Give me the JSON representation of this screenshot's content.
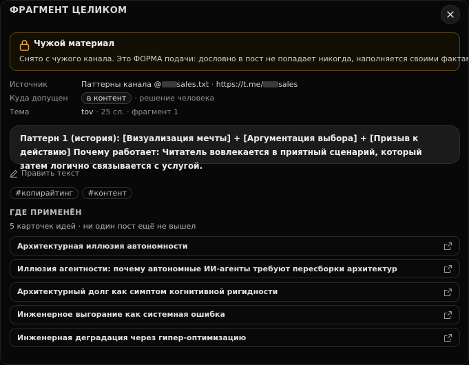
{
  "modal": {
    "title": "ФРАГМЕНТ ЦЕЛИКОМ",
    "close_icon": "close-icon"
  },
  "warning": {
    "icon": "lock-icon",
    "title": "Чужой материал",
    "text": "Снято с чужого канала. Это ФОРМА подачи: дословно в пост не попадает никогда, наполняется своими фактами.",
    "border_color": "#5e4617"
  },
  "meta": {
    "source": {
      "label": "Источник",
      "file_prefix": "Паттерны канала @",
      "file_suffix": "sales.txt",
      "url_sep": " · ",
      "url_prefix": "https://t.me/",
      "url_suffix": "sales"
    },
    "allowed": {
      "label": "Куда допущен",
      "pill": "в контент",
      "note": "· решение человека"
    },
    "topic": {
      "label": "Тема",
      "value": "tov",
      "note": "· 25 сл. · фрагмент 1"
    }
  },
  "fragment": {
    "text": "Паттерн 1 (история): [Визуализация мечты] + [Аргументация выбора] + [Призыв к действию] Почему работает: Читатель вовлекается в приятный сценарий, который затем логично связывается с услугой."
  },
  "edit": {
    "icon": "pencil-icon",
    "label": "Править текст"
  },
  "tags": [
    "#копирайтинг",
    "#контент"
  ],
  "usage": {
    "title": "ГДЕ ПРИМЕНЁН",
    "subtitle": "5 карточек идей · ни один пост ещё не вышел",
    "items": [
      "Архитектурная иллюзия автономности",
      "Иллюзия агентности: почему автономные ИИ-агенты требуют пересборки архитектур",
      "Архитектурный долг как симптом когнитивной ригидности",
      "Инженерное выгорание как системная ошибка",
      "Инженерная деградация через гипер-оптимизацию"
    ],
    "item_icon": "external-link-icon"
  }
}
